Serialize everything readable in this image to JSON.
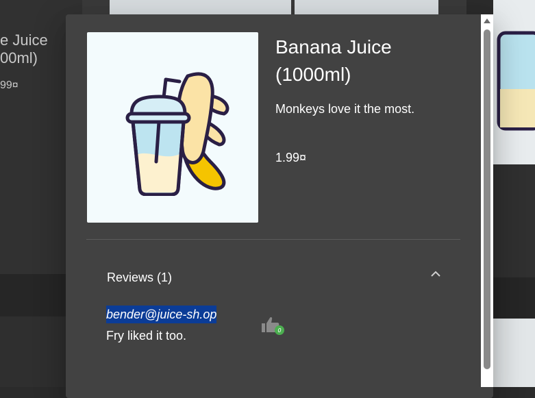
{
  "background": {
    "left_card_title": "e Juice\n00ml)",
    "left_card_price": "99¤"
  },
  "product": {
    "title": "Banana Juice (1000ml)",
    "description": "Monkeys love it the most.",
    "price": "1.99¤",
    "image_icon": "banana-juice-image"
  },
  "reviews": {
    "header": "Reviews (1)",
    "expanded": true,
    "items": [
      {
        "author": "bender@juice-sh.op",
        "text": "Fry liked it too."
      }
    ]
  },
  "colors": {
    "dialog_bg": "#424242",
    "author_highlight": "#0b3c97",
    "like_badge": "#4caf50"
  }
}
